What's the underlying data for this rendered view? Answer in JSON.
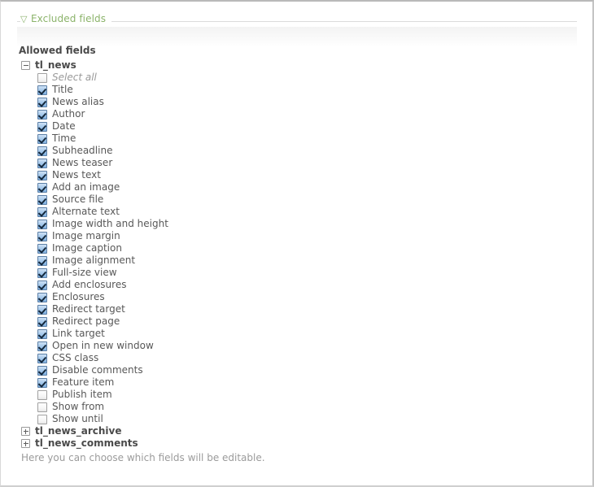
{
  "fieldset": {
    "legend_label": "Excluded fields",
    "legend_icon": "triangle-down-icon",
    "expanded": true
  },
  "widget": {
    "label": "Allowed fields",
    "help_text": "Here you can choose which fields will be editable."
  },
  "tree": {
    "groups": [
      {
        "name": "tl_news",
        "expanded": true,
        "toggle_icon": "minus-box-icon",
        "fields": [
          {
            "label": "Select all",
            "checked": false,
            "select_all": true
          },
          {
            "label": "Title",
            "checked": true
          },
          {
            "label": "News alias",
            "checked": true
          },
          {
            "label": "Author",
            "checked": true
          },
          {
            "label": "Date",
            "checked": true
          },
          {
            "label": "Time",
            "checked": true
          },
          {
            "label": "Subheadline",
            "checked": true
          },
          {
            "label": "News teaser",
            "checked": true
          },
          {
            "label": "News text",
            "checked": true
          },
          {
            "label": "Add an image",
            "checked": true
          },
          {
            "label": "Source file",
            "checked": true
          },
          {
            "label": "Alternate text",
            "checked": true
          },
          {
            "label": "Image width and height",
            "checked": true
          },
          {
            "label": "Image margin",
            "checked": true
          },
          {
            "label": "Image caption",
            "checked": true
          },
          {
            "label": "Image alignment",
            "checked": true
          },
          {
            "label": "Full-size view",
            "checked": true
          },
          {
            "label": "Add enclosures",
            "checked": true
          },
          {
            "label": "Enclosures",
            "checked": true
          },
          {
            "label": "Redirect target",
            "checked": true
          },
          {
            "label": "Redirect page",
            "checked": true
          },
          {
            "label": "Link target",
            "checked": true
          },
          {
            "label": "Open in new window",
            "checked": true
          },
          {
            "label": "CSS class",
            "checked": true
          },
          {
            "label": "Disable comments",
            "checked": true
          },
          {
            "label": "Feature item",
            "checked": true
          },
          {
            "label": "Publish item",
            "checked": false
          },
          {
            "label": "Show from",
            "checked": false
          },
          {
            "label": "Show until",
            "checked": false
          }
        ]
      },
      {
        "name": "tl_news_archive",
        "expanded": false,
        "toggle_icon": "plus-box-icon",
        "fields": []
      },
      {
        "name": "tl_news_comments",
        "expanded": false,
        "toggle_icon": "plus-box-icon",
        "fields": []
      }
    ]
  },
  "colors": {
    "legend_green": "#8bb36a",
    "label_dark": "#4a4a4a",
    "field_text": "#585858",
    "muted": "#9a9a9a",
    "checkbox_blue": "#7fb0e0"
  }
}
